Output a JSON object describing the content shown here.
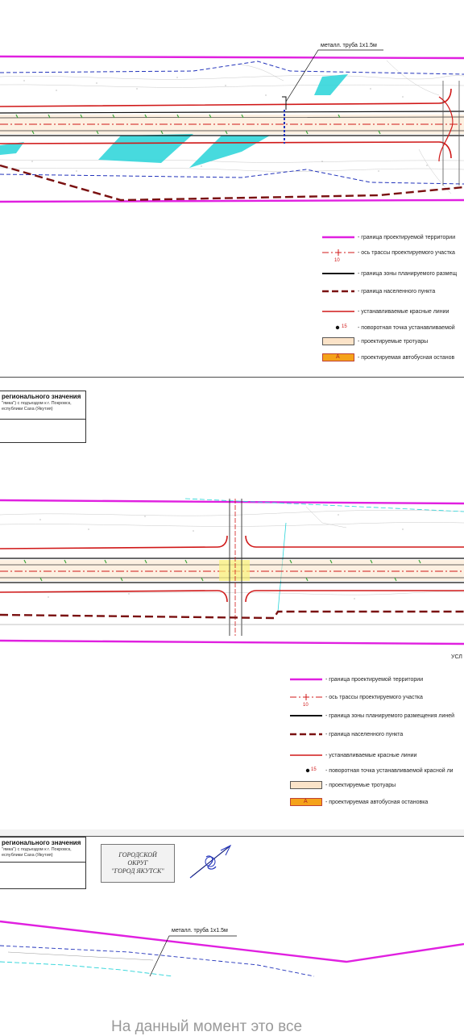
{
  "sheet1": {
    "callout": "металл. труба 1х1.5м",
    "legend": [
      {
        "key": "border",
        "label": "- граница проектируемой территории"
      },
      {
        "key": "axis",
        "label": "- ось трассы проектируемого участка",
        "num": "10"
      },
      {
        "key": "zone",
        "label": "- граница зоны планируемого размещ"
      },
      {
        "key": "settlement",
        "label": "- граница населенного пункта"
      },
      {
        "key": "redline",
        "label": "- устанавливаемые красные линии"
      },
      {
        "key": "point",
        "label": "- поворотная точка устанавливаемой",
        "num": "15"
      },
      {
        "key": "sidewalk",
        "label": "- проектируемые тротуары"
      },
      {
        "key": "bus",
        "label": "- проектируемая автобусная останов",
        "letter": "А"
      }
    ],
    "title": "регионального значения",
    "subtitle": "\"ямка\") с подъездом к г. Покровск,\nеспублики Саха (Якутия)"
  },
  "sheet2": {
    "corner_label": "УСЛ",
    "legend": [
      {
        "key": "border",
        "label": "- граница проектируемой территории"
      },
      {
        "key": "axis",
        "label": "- ось трассы проектируемого участка",
        "num": "10"
      },
      {
        "key": "zone",
        "label": "- граница зоны планируемого размещения линей"
      },
      {
        "key": "settlement",
        "label": "- граница населенного пункта"
      },
      {
        "key": "redline",
        "label": "- устанавливаемые красные линии"
      },
      {
        "key": "point",
        "label": "- поворотная точка устанавливаемой красной ли",
        "num": "15"
      },
      {
        "key": "sidewalk",
        "label": "- проектируемые тротуары"
      },
      {
        "key": "bus",
        "label": "- проектируемая автобусная остановка",
        "letter": "А"
      }
    ],
    "title": "регионального значения",
    "subtitle": "\"ямка\") с подъездом к г. Покровск,\nеспублики Саха (Якутия)",
    "stamp": "ГОРОДСКОЙ\nОКРУГ\n\"ГОРОД ЯКУТСК\""
  },
  "sheet3": {
    "callout": "металл. труба 1х1.5м"
  },
  "footer_text": "На данный момент это все",
  "colors": {
    "border": "#e020e0",
    "red": "#d01818",
    "darkred": "#7a1010",
    "cyan": "#27d3d8",
    "blue": "#2233bb",
    "sidewalk": "#fbe3c8",
    "bus": "#f5a21a"
  }
}
